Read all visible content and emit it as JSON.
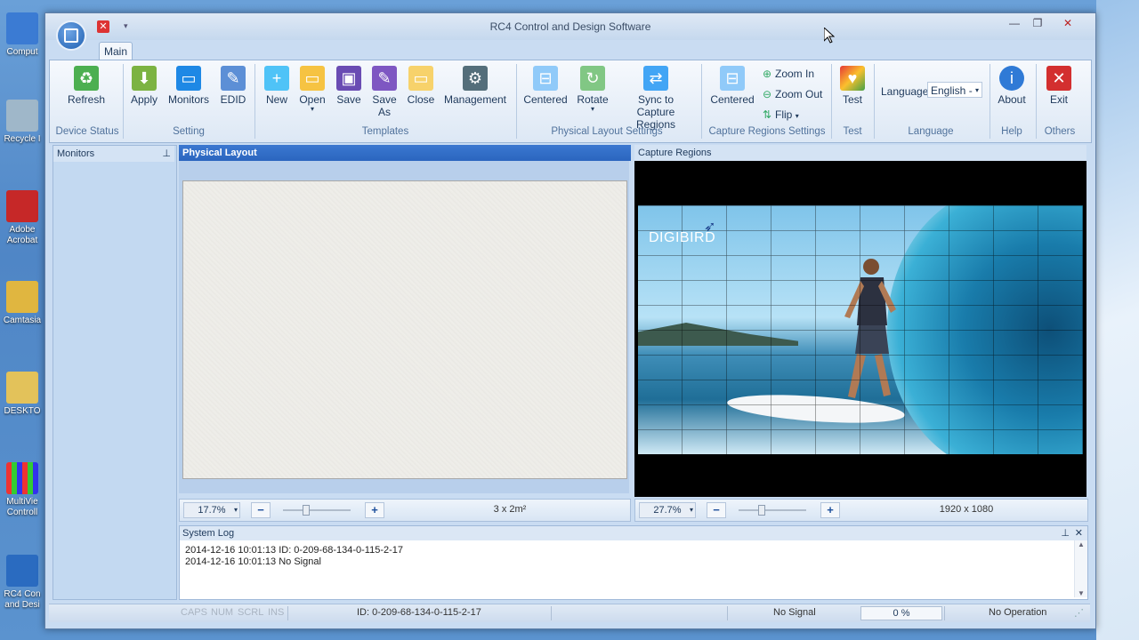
{
  "desktop": {
    "icons": [
      {
        "label": "Comput",
        "color": "#3b7bd3"
      },
      {
        "label": "Recycle I",
        "color": "#9fb7c9"
      },
      {
        "label": "Adobe Acrobat",
        "color": "#c62828"
      },
      {
        "label": "Camtasia",
        "color": "#e0b640"
      },
      {
        "label": "DESKTO",
        "color": "#e3c25a"
      },
      {
        "label": "MultiVie Controll",
        "color": "#5b3aa0"
      },
      {
        "label": "RC4 Con and Desi",
        "color": "#2a6bc0"
      }
    ]
  },
  "window": {
    "title": "RC4 Control and Design Software",
    "minimize_icon": "minimize-icon",
    "maximize_icon": "maximize-icon",
    "close_icon": "close-icon"
  },
  "ribbon": {
    "tab": "Main",
    "groups": {
      "device_status": "Device Status",
      "setting": "Setting",
      "templates": "Templates",
      "physical_layout_settings": "Physical Layout Settings",
      "capture_regions_settings": "Capture Regions Settings",
      "test": "Test",
      "language": "Language",
      "help": "Help",
      "others": "Others"
    },
    "buttons": {
      "refresh": "Refresh",
      "apply": "Apply",
      "monitors": "Monitors",
      "edid": "EDID",
      "new": "New",
      "open": "Open",
      "save": "Save",
      "save_as_1": "Save",
      "save_as_2": "As",
      "close": "Close",
      "management": "Management",
      "centered_phys": "Centered",
      "rotate": "Rotate",
      "sync_1": "Sync to Capture",
      "sync_2": "Regions",
      "centered_cap": "Centered",
      "zoom_in": "Zoom In",
      "zoom_out": "Zoom Out",
      "flip": "Flip",
      "test": "Test",
      "language_label": "Language",
      "language_value": "English -",
      "about": "About",
      "exit": "Exit"
    },
    "colors": {
      "accent": "#2b65bf",
      "exit": "#d32f2f",
      "about": "#2f7ad6"
    }
  },
  "panes": {
    "monitors": "Monitors",
    "physical_layout": "Physical Layout",
    "capture_regions": "Capture Regions",
    "system_log": "System Log"
  },
  "capture": {
    "logo": "DIGIBIRD"
  },
  "physical_zoom": {
    "zoom": "17.7%",
    "info": "3 x 2m²"
  },
  "capture_zoom": {
    "zoom": "27.7%",
    "info": "1920 x 1080"
  },
  "log": {
    "lines": [
      "2014-12-16 10:01:13 ID:  0-209-68-134-0-115-2-17",
      "2014-12-16 10:01:13 No Signal"
    ]
  },
  "status": {
    "caps": "CAPS",
    "num": "NUM",
    "scrl": "SCRL",
    "ins": "INS",
    "id": "ID:  0-209-68-134-0-115-2-17",
    "signal": "No Signal",
    "progress": "0 %",
    "operation": "No Operation"
  }
}
